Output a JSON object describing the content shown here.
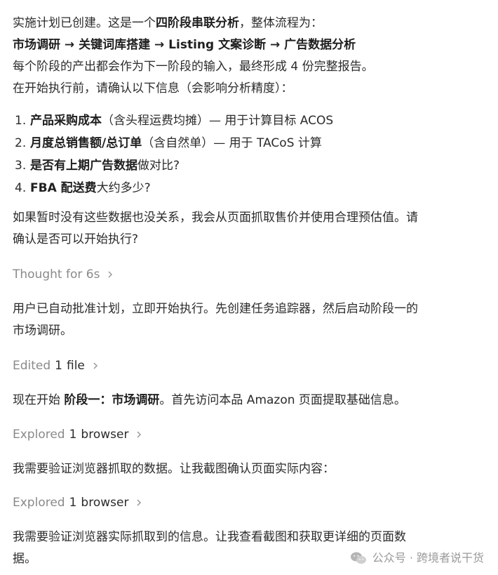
{
  "intro": {
    "line1_prefix": "实施计划已创建。这是一个",
    "line1_bold": "四阶段串联分析",
    "line1_suffix": "，整体流程为：",
    "flow": "市场调研 → 关键词库搭建 → Listing 文案诊断 → 广告数据分析",
    "line3": "每个阶段的产出都会作为下一阶段的输入，最终形成 4 份完整报告。",
    "line4": "在开始执行前，请确认以下信息（会影响分析精度）："
  },
  "questions": [
    {
      "num": "1.",
      "bold": "产品采购成本",
      "rest": "（含头程运费均摊）— 用于计算目标 ACOS"
    },
    {
      "num": "2.",
      "bold": "月度总销售额/总订单",
      "rest": "（含自然单）— 用于 TACoS 计算"
    },
    {
      "num": "3.",
      "bold": "是否有上期广告数据",
      "rest": "做对比?"
    },
    {
      "num": "4.",
      "bold": "FBA 配送费",
      "rest": "大约多少?"
    }
  ],
  "note": {
    "line1": "如果暂时没有这些数据也没关系，我会从页面抓取售价并使用合理预估值。请",
    "line2": "确认是否可以开始执行?"
  },
  "thought": {
    "label": "Thought for 6s"
  },
  "msg1": {
    "line1": "用户已自动批准计划，立即开始执行。先创建任务追踪器，然后启动阶段一的",
    "line2": "市场调研。"
  },
  "edited": {
    "verb": "Edited",
    "count": "1",
    "noun": "file"
  },
  "msg2": {
    "prefix": "现在开始 ",
    "bold": "阶段一：市场调研",
    "suffix": "。首先访问本品 Amazon 页面提取基础信息。"
  },
  "explored1": {
    "verb": "Explored",
    "count": "1",
    "noun": "browser"
  },
  "msg3": {
    "line1": "我需要验证浏览器抓取的数据。让我截图确认页面实际内容："
  },
  "explored2": {
    "verb": "Explored",
    "count": "1",
    "noun": "browser"
  },
  "msg4": {
    "line1": "我需要验证浏览器实际抓取到的信息。让我查看截图和获取更详细的页面数",
    "line2": "据。"
  },
  "watermark": {
    "text": "公众号 · 跨境者说干货",
    "icon": "wechat-icon"
  },
  "colors": {
    "text": "#2b2b2b",
    "muted": "#8a8a8a",
    "background": "#ffffff"
  }
}
